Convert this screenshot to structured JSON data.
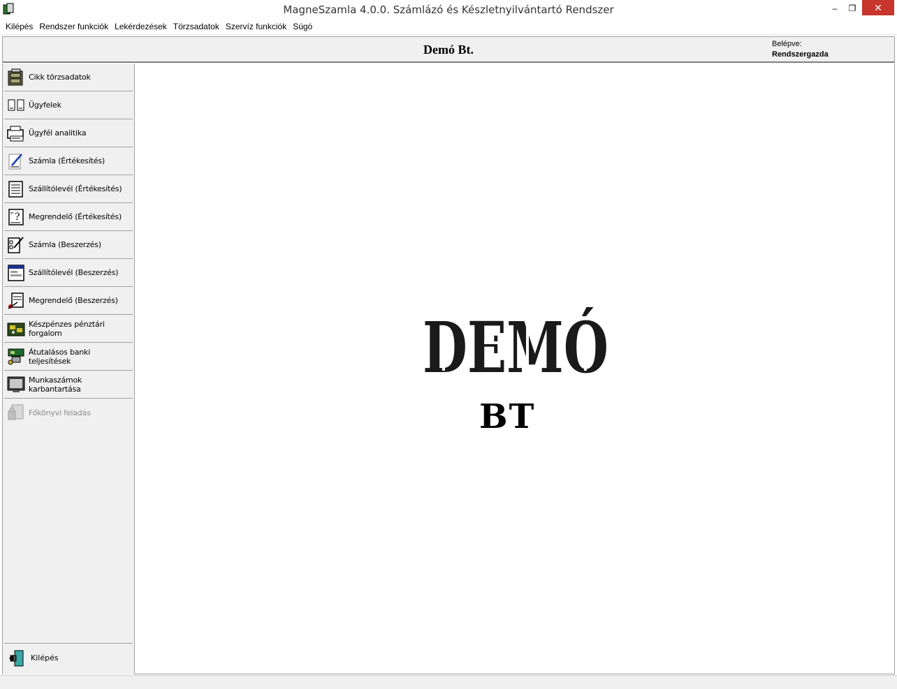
{
  "window": {
    "title": "MagneSzamla 4.0.0. Számlázó és Készletnyilvántartó Rendszer",
    "minimize_glyph": "–",
    "restore_glyph": "❐",
    "close_glyph": "✕"
  },
  "menu": [
    {
      "label": "Kilépés"
    },
    {
      "label": "Rendszer funkciók"
    },
    {
      "label": "Lekérdezések"
    },
    {
      "label": "Törzsadatok"
    },
    {
      "label": "Szervíz funkciók"
    },
    {
      "label": "Súgó"
    }
  ],
  "header": {
    "company": "Demó Bt.",
    "login_label": "Belépve:",
    "login_user": "Rendszergazda"
  },
  "sidebar": {
    "items": [
      {
        "label": "Cikk törzsadatok",
        "icon": "cabinet-icon"
      },
      {
        "label": "Ügyfelek",
        "icon": "clients-icon"
      },
      {
        "label": "Ügyfél analitika",
        "icon": "printer-icon"
      },
      {
        "label": "Számla (Értékesítés)",
        "icon": "pen-document-icon"
      },
      {
        "label": "Szállítólevél (Értékesítés)",
        "icon": "delivery-note-icon"
      },
      {
        "label": "Megrendelő (Értékesítés)",
        "icon": "order-icon"
      },
      {
        "label": "Számla (Beszerzés)",
        "icon": "checklist-icon"
      },
      {
        "label": "Szállítólevél (Beszerzés)",
        "icon": "form-window-icon"
      },
      {
        "label": "Megrendelő (Beszerzés)",
        "icon": "clipboard-icon"
      },
      {
        "label": "Készpénzes pénztári forgalom",
        "icon": "cash-icon"
      },
      {
        "label": "Átutalásos banki teljesítések",
        "icon": "bank-transfer-icon"
      },
      {
        "label": "Munkaszámok karbantartása",
        "icon": "monitor-icon"
      },
      {
        "label": "Főkönyvi feladás",
        "icon": "ledger-icon",
        "disabled": true
      }
    ],
    "exit_label": "Kilépés"
  },
  "main": {
    "logo_text": "DEMÓ",
    "logo_sub": "BT"
  }
}
